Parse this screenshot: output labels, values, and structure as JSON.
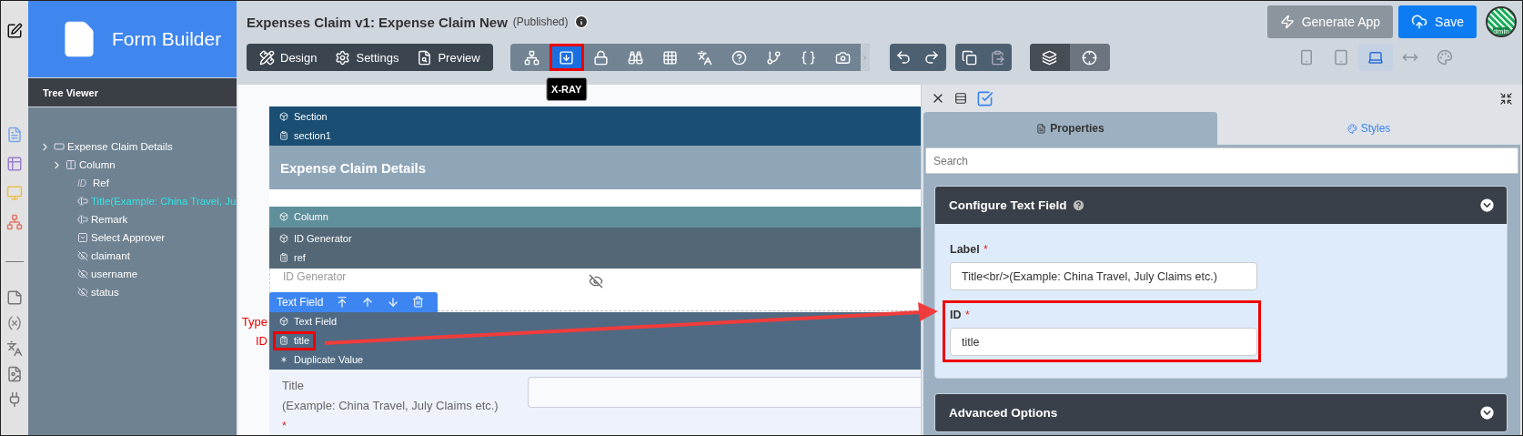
{
  "sidebar": {
    "title": "Form Builder"
  },
  "tree_viewer": {
    "title": "Tree Viewer",
    "items": [
      {
        "kind": "section",
        "label": "Expense Claim Details",
        "selected": false,
        "children": [
          {
            "kind": "column",
            "label": "Column",
            "selected": false,
            "children": [
              {
                "kind": "id",
                "icon_label": "ID",
                "label": "Ref",
                "selected": false
              },
              {
                "kind": "text",
                "label": "Title(Example: China Travel, Ju",
                "selected": true
              },
              {
                "kind": "text",
                "label": "Remark",
                "selected": false
              },
              {
                "kind": "select",
                "label": "Select Approver",
                "selected": false
              },
              {
                "kind": "hidden",
                "label": "claimant",
                "selected": false
              },
              {
                "kind": "hidden",
                "label": "username",
                "selected": false
              },
              {
                "kind": "hidden",
                "label": "status",
                "selected": false
              }
            ]
          }
        ]
      }
    ]
  },
  "header": {
    "title": "Expenses Claim v1: Expense Claim New",
    "status": "(Published)"
  },
  "modes": [
    {
      "kind": "design",
      "label": "Design"
    },
    {
      "kind": "settings",
      "label": "Settings"
    },
    {
      "kind": "preview",
      "label": "Preview"
    }
  ],
  "tools": [
    {
      "kind": "hierarchy",
      "selected": false,
      "highlighted": false
    },
    {
      "kind": "xray",
      "selected": true,
      "highlighted": true,
      "tooltip": "X-RAY"
    },
    {
      "kind": "lock",
      "selected": false,
      "highlighted": false
    },
    {
      "kind": "binoculars",
      "selected": false,
      "highlighted": false
    },
    {
      "kind": "grid",
      "selected": false,
      "highlighted": false
    },
    {
      "kind": "translate",
      "selected": false,
      "highlighted": false
    },
    {
      "kind": "help",
      "selected": false,
      "highlighted": false
    },
    {
      "kind": "branch",
      "selected": false,
      "highlighted": false
    },
    {
      "kind": "braces",
      "selected": false,
      "highlighted": false
    },
    {
      "kind": "camera",
      "selected": false,
      "highlighted": false
    }
  ],
  "view_toggles": [
    {
      "kind": "layers",
      "selected": true
    },
    {
      "kind": "target",
      "selected": false
    }
  ],
  "devices": [
    {
      "kind": "mobile",
      "selected": false
    },
    {
      "kind": "tablet",
      "selected": false
    },
    {
      "kind": "laptop",
      "selected": true
    },
    {
      "kind": "stretch",
      "selected": false
    },
    {
      "kind": "palette",
      "selected": false
    }
  ],
  "actions": {
    "generate": "Generate App",
    "save": "Save"
  },
  "user": {
    "avatar_text": "dmin"
  },
  "canvas": {
    "section": {
      "rows": [
        {
          "kind": "type",
          "text": "Section"
        },
        {
          "kind": "id",
          "text": "section1"
        }
      ],
      "title": "Expense Claim Details"
    },
    "column": {
      "rows": [
        {
          "kind": "type",
          "text": "Column"
        }
      ]
    },
    "id_generator": {
      "rows": [
        {
          "kind": "type",
          "text": "ID Generator"
        },
        {
          "kind": "id",
          "text": "ref"
        }
      ],
      "label": "ID Generator"
    },
    "text_field": {
      "toolbar_label": "Text Field",
      "rows": [
        {
          "kind": "type",
          "text": "Text Field",
          "annotation": "Type",
          "highlighted": false
        },
        {
          "kind": "id",
          "text": "title",
          "annotation": "ID",
          "highlighted": true
        },
        {
          "kind": "validation",
          "text": "Duplicate Value",
          "highlighted": false
        }
      ],
      "label": "Title",
      "hint": "(Example: China Travel, July Claims etc.)",
      "required_mark": "*"
    }
  },
  "properties_panel": {
    "tabs": [
      {
        "kind": "properties",
        "label": "Properties",
        "selected": true
      },
      {
        "kind": "styles",
        "label": "Styles",
        "selected": false
      }
    ],
    "search": {
      "placeholder": "Search"
    },
    "sections": [
      {
        "title": "Configure Text Field",
        "has_help": true,
        "fields": [
          {
            "label": "Label",
            "required_mark": "*",
            "value": "Title<br/>(Example: China Travel, July Claims etc.)",
            "highlighted": false
          },
          {
            "label": "ID",
            "required_mark": "*",
            "value": "title",
            "highlighted": true
          }
        ]
      },
      {
        "title": "Advanced Options",
        "has_help": false
      }
    ]
  }
}
